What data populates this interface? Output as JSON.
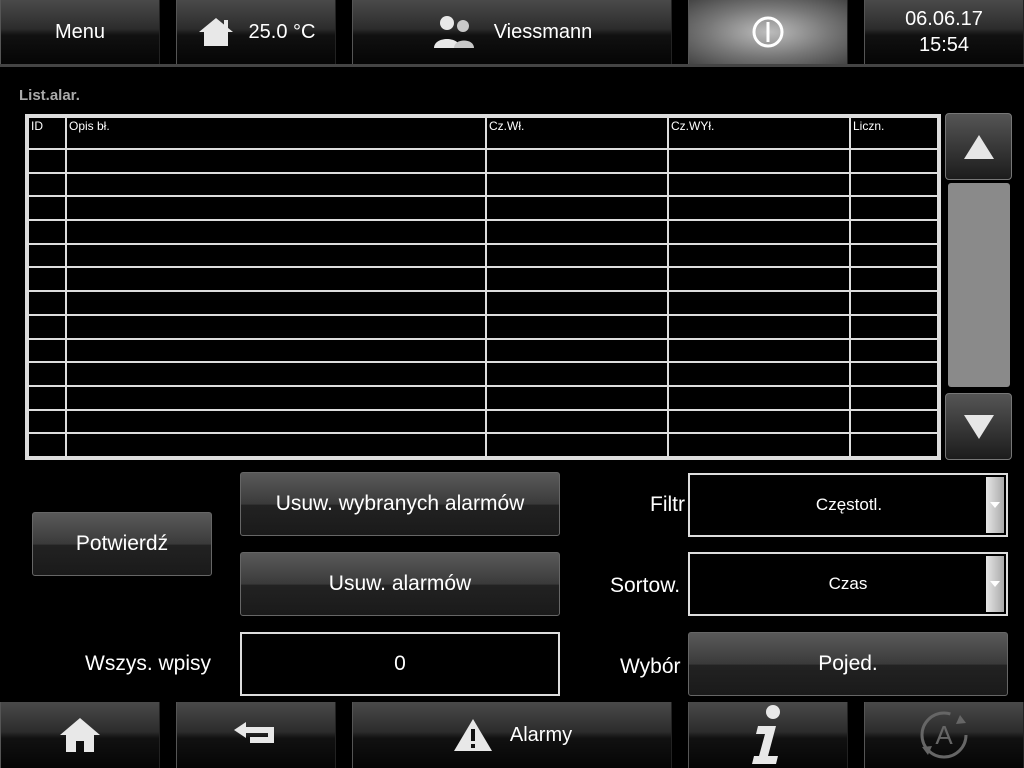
{
  "header": {
    "menu_label": "Menu",
    "temperature": "25.0 °C",
    "user_name": "Viessmann",
    "date": "06.06.17",
    "time": "15:54"
  },
  "page": {
    "title": "List.alar."
  },
  "table": {
    "columns": [
      "ID",
      "Opis bł.",
      "Cz.Wł.",
      "Cz.WYł.",
      "Liczn."
    ],
    "rows": []
  },
  "actions": {
    "confirm_label": "Potwierdź",
    "delete_selected_label": "Usuw. wybranych alarmów",
    "delete_all_label": "Usuw. alarmów",
    "all_entries_label": "Wszys. wpisy",
    "all_entries_value": "0"
  },
  "filters": {
    "filter_label": "Filtr",
    "filter_value": "Częstotl.",
    "sort_label": "Sortow.",
    "sort_value": "Czas",
    "selection_label": "Wybór",
    "selection_value": "Pojed."
  },
  "footer": {
    "alarms_label": "Alarmy"
  },
  "icons": {
    "home": "home-icon",
    "users": "users-icon",
    "power": "power-icon",
    "back": "back-icon",
    "warning": "warning-icon",
    "info": "info-icon",
    "auto": "auto-mode-icon"
  }
}
